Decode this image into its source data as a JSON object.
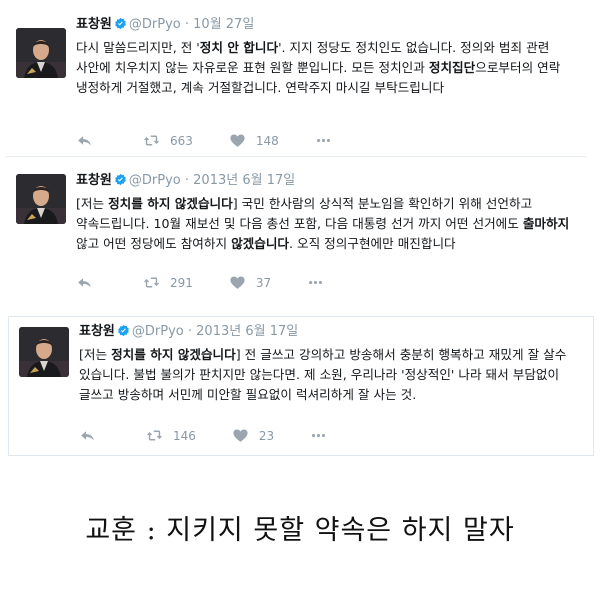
{
  "tweets": [
    {
      "name": "표창원",
      "handle": "@DrPyo",
      "dot": "·",
      "date": "10월 27일",
      "text": [
        {
          "t": "다시 말씀드리지만, 전 '",
          "b": false
        },
        {
          "t": "정치 안 합니다",
          "b": true
        },
        {
          "t": "'. 지지 정당도 정치인도 없습니다. 정의와 범죄 관련 사안에 치우치지 않는 자유로운 표현 원할 뿐입니다. 모든 정치인과 ",
          "b": false
        },
        {
          "t": "정치집단",
          "b": true
        },
        {
          "t": "으로부터의 연락 냉정하게 거절했고, 계속 거절할겁니다. 연락주지 마시길 부탁드립니다",
          "b": false
        }
      ],
      "retweets": "663",
      "likes": "148"
    },
    {
      "name": "표창원",
      "handle": "@DrPyo",
      "dot": "·",
      "date": "2013년 6월 17일",
      "text": [
        {
          "t": "[저는 ",
          "b": false
        },
        {
          "t": "정치를 하지 않겠습니다",
          "b": true
        },
        {
          "t": "] 국민 한사람의 상식적 분노임을 확인하기 위해 선언하고 약속드립니다. 10월 재보선 및 다음 총선 포함, 다음 대통령 선거 까지 어떤 선거에도 ",
          "b": false
        },
        {
          "t": "출마하지",
          "b": true
        },
        {
          "t": " 않고 어떤 정당에도 참여하지 ",
          "b": false
        },
        {
          "t": "않겠습니다",
          "b": true
        },
        {
          "t": ". 오직 정의구현에만 매진합니다",
          "b": false
        }
      ],
      "retweets": "291",
      "likes": "37"
    },
    {
      "name": "표창원",
      "handle": "@DrPyo",
      "dot": "·",
      "date": "2013년 6월 17일",
      "text": [
        {
          "t": "[저는 ",
          "b": false
        },
        {
          "t": "정치를 하지 않겠습니다",
          "b": true
        },
        {
          "t": "] 전 글쓰고 강의하고 방송해서 충분히 행복하고 재밌게 잘 살수 있습니다. 불법 불의가 판치지만 않는다면. 제 소원, 우리나라 '정상적인' 나라 돼서 부담없이 글쓰고 방송하며 서민께 미안할 필요없이 럭셔리하게 잘 사는 것.",
          "b": false
        }
      ],
      "retweets": "146",
      "likes": "23"
    }
  ],
  "caption": "교훈 : 지키지 못할 약속은 하지 말자",
  "colors": {
    "accent": "#1da1f2",
    "muted": "#8899a6",
    "icon": "#9aa5b0"
  },
  "icons": [
    "reply-icon",
    "retweet-icon",
    "heart-icon",
    "more-icon",
    "verified-badge-icon"
  ]
}
